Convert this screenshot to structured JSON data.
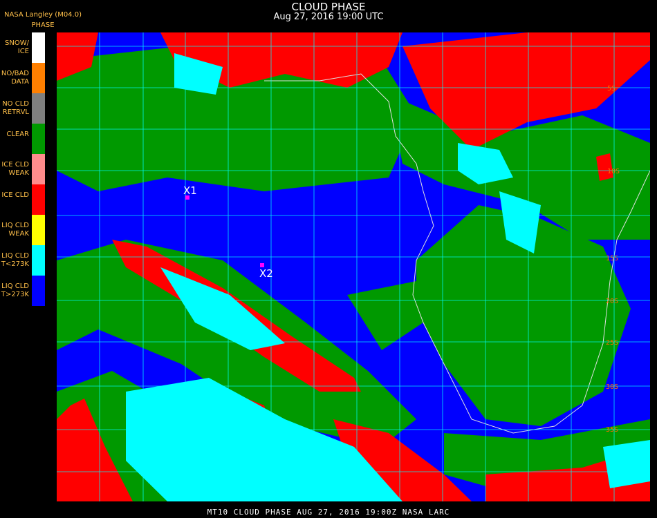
{
  "header": {
    "producer": "NASA Langley (M04.0)",
    "legend_title": "PHASE",
    "title": "CLOUD PHASE",
    "date": "Aug 27, 2016 19:00 UTC"
  },
  "legend": [
    {
      "label": "SNOW/\nICE",
      "color": "#ffffff"
    },
    {
      "label": "NO/BAD\nDATA",
      "color": "#ff7f00"
    },
    {
      "label": "NO CLD\nRETRVL",
      "color": "#7f7f7f"
    },
    {
      "label": "CLEAR",
      "color": "#009900"
    },
    {
      "label": "ICE CLD\nWEAK",
      "color": "#ff8c8c"
    },
    {
      "label": "ICE CLD",
      "color": "#ff0000"
    },
    {
      "label": "LIQ CLD\nWEAK",
      "color": "#ffff00"
    },
    {
      "label": "LIQ CLD\nT<273K",
      "color": "#00ffff"
    },
    {
      "label": "LIQ CLD\nT>273K",
      "color": "#0000ff"
    }
  ],
  "map": {
    "latitude_labels": [
      "5S",
      "10S",
      "15S",
      "20S",
      "25S",
      "30S",
      "35S"
    ],
    "markers": [
      "X1",
      "X2"
    ]
  },
  "footer": "MT10  CLOUD PHASE   AUG 27, 2016 19:00Z   NASA LARC"
}
